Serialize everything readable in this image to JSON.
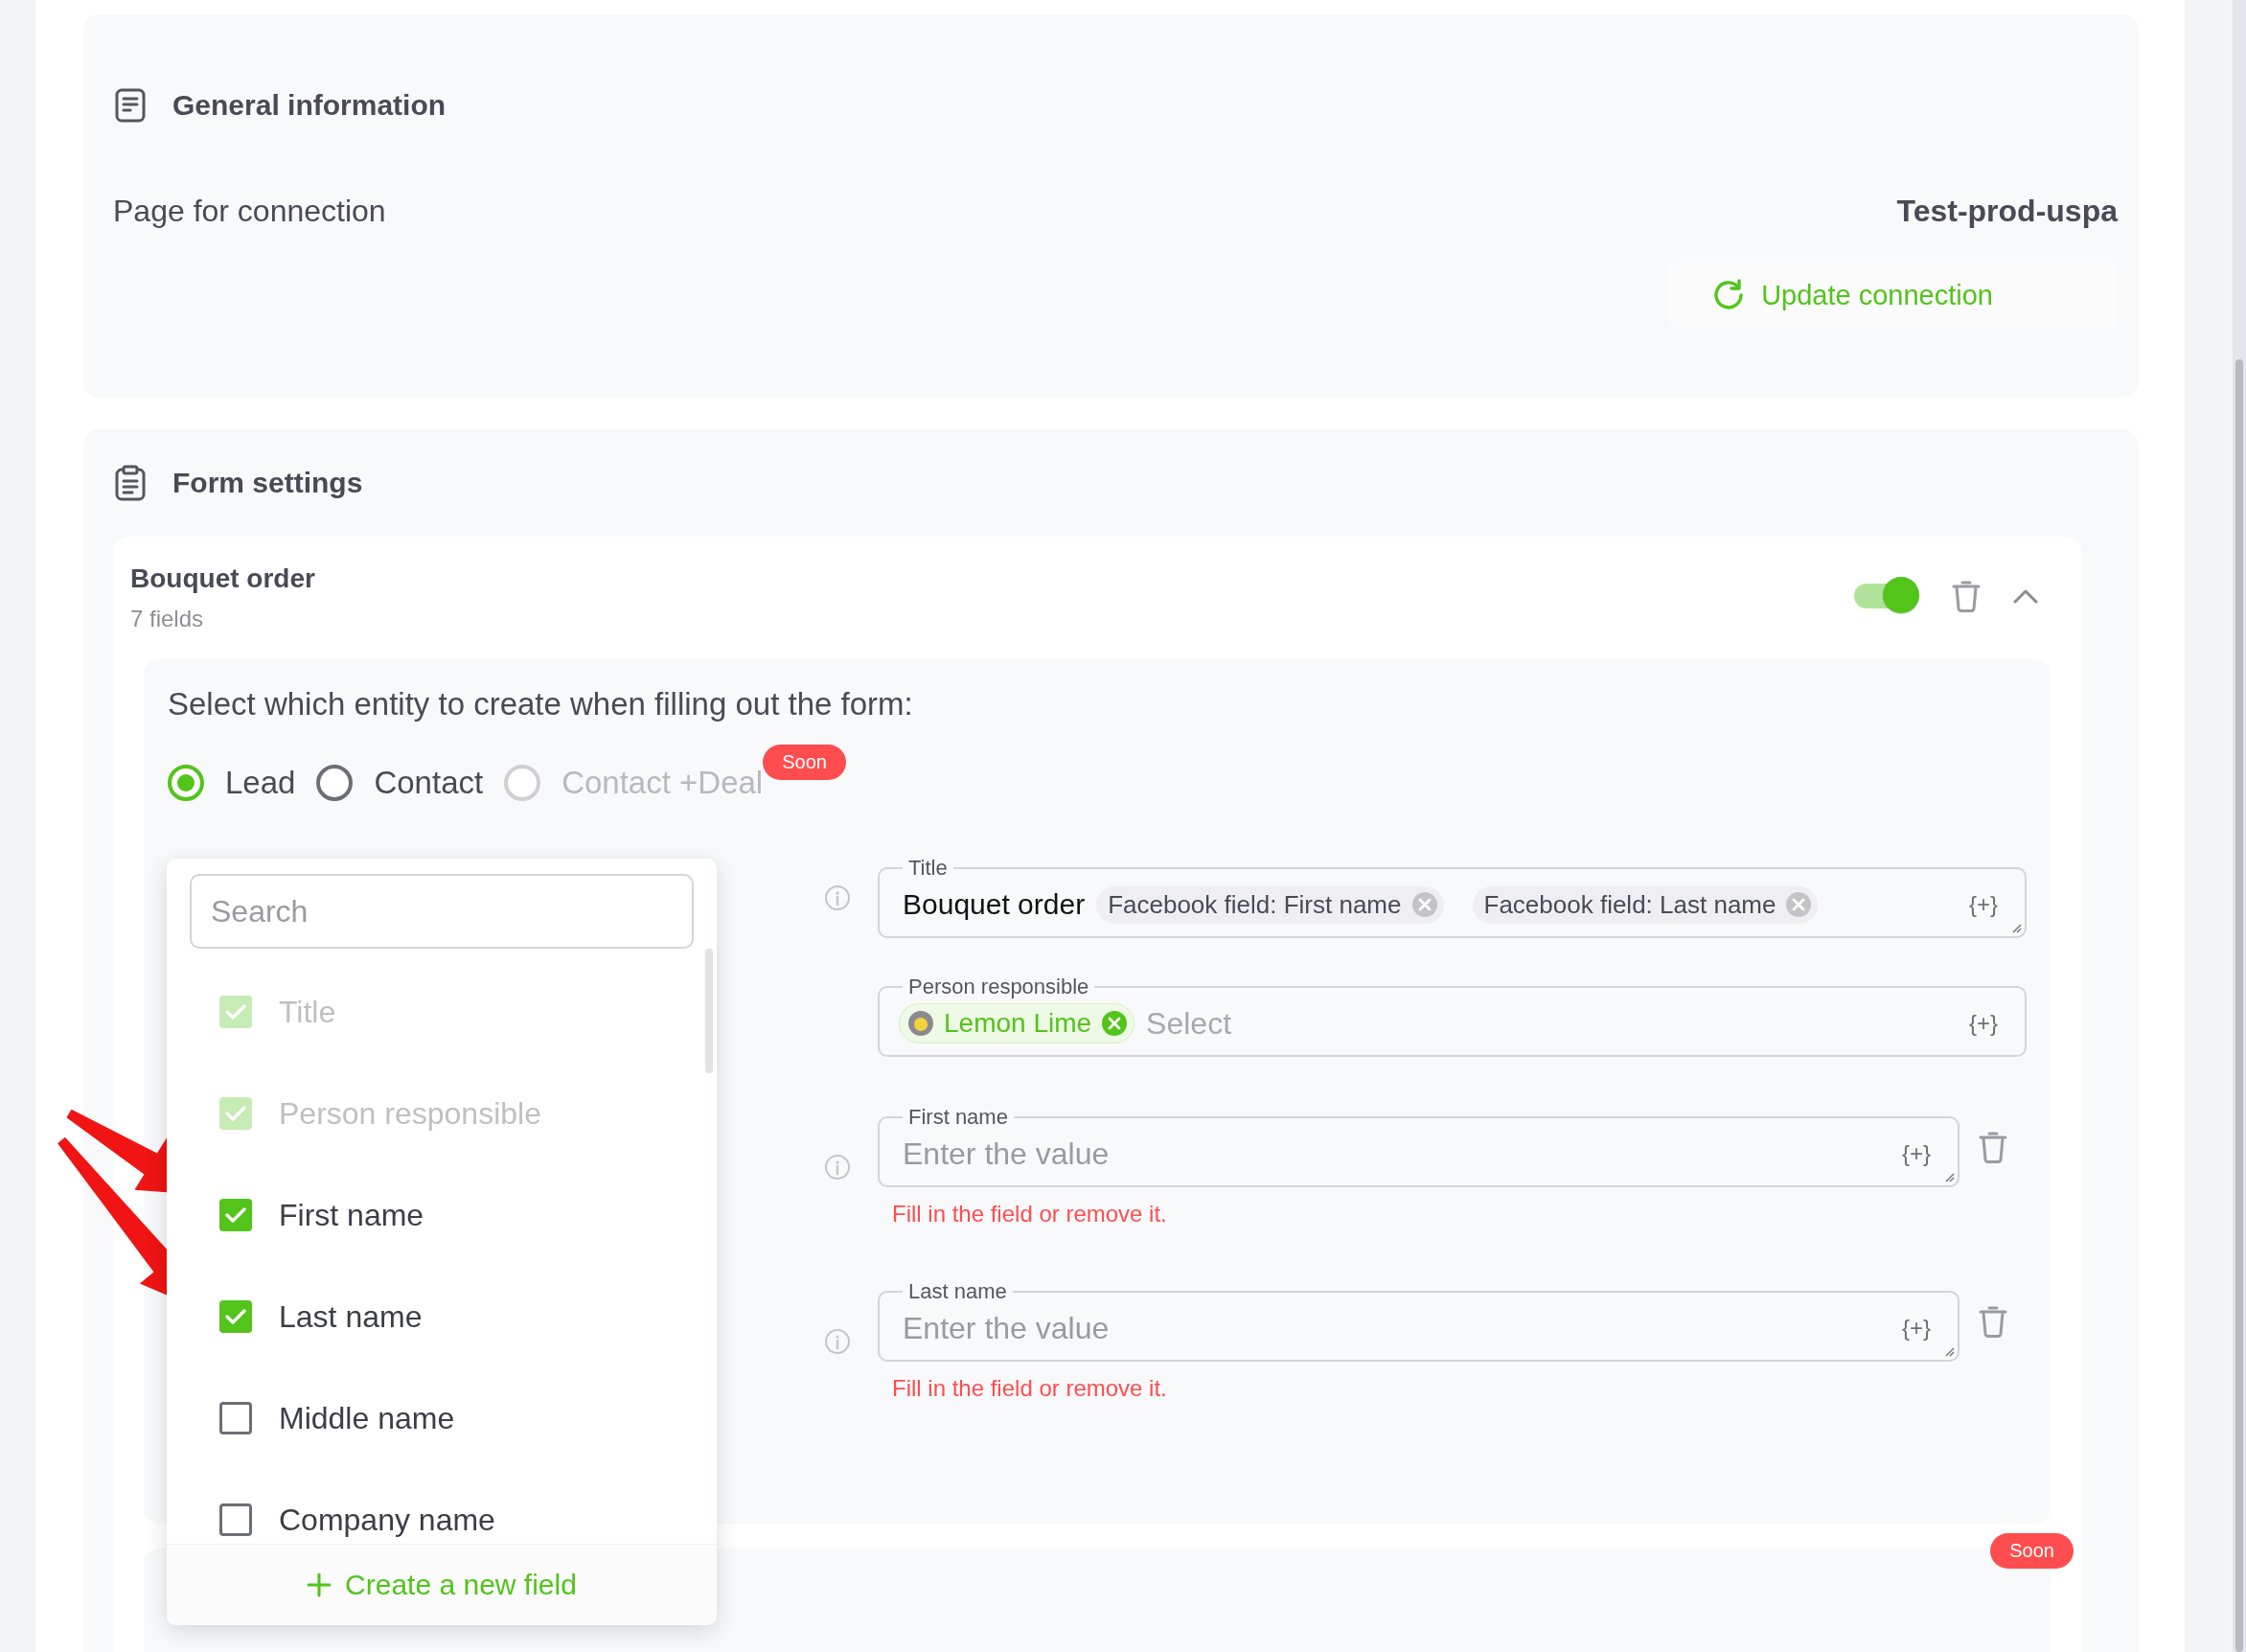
{
  "general": {
    "title": "General information",
    "page_label": "Page for connection",
    "page_value": "Test-prod-uspa",
    "update_button": "Update connection"
  },
  "form_settings": {
    "title": "Form settings",
    "form": {
      "name": "Bouquet order",
      "field_count": "7 fields",
      "enabled": true,
      "expanded": true,
      "entity_prompt": "Select which entity to create when filling out the form:",
      "entities": [
        {
          "label": "Lead",
          "selected": true,
          "disabled": false
        },
        {
          "label": "Contact",
          "selected": false,
          "disabled": false
        },
        {
          "label": "Contact +Deal",
          "selected": false,
          "disabled": true,
          "badge": "Soon"
        }
      ],
      "field_picker": {
        "search_placeholder": "Search",
        "items": [
          {
            "label": "Title",
            "checked": true,
            "disabled": true
          },
          {
            "label": "Person responsible",
            "checked": true,
            "disabled": true
          },
          {
            "label": "First name",
            "checked": true,
            "disabled": false
          },
          {
            "label": "Last name",
            "checked": true,
            "disabled": false
          },
          {
            "label": "Middle name",
            "checked": false,
            "disabled": false
          },
          {
            "label": "Company name",
            "checked": false,
            "disabled": false
          }
        ],
        "create_button": "Create a new field"
      },
      "fields": [
        {
          "kind": "tags",
          "label": "Title",
          "value": "Bouquet order",
          "tags": [
            "Facebook field: First name",
            "Facebook field: Last name"
          ],
          "insert": "{+}",
          "info": true,
          "removable": false
        },
        {
          "kind": "user",
          "label": "Person responsible",
          "user": "Lemon Lime",
          "placeholder": "Select",
          "insert": "{+}",
          "info": false,
          "removable": false
        },
        {
          "kind": "text",
          "label": "First name",
          "placeholder": "Enter the value",
          "insert": "{+}",
          "error": "Fill in the field or remove it.",
          "info": true,
          "removable": true
        },
        {
          "kind": "text",
          "label": "Last name",
          "placeholder": "Enter the value",
          "insert": "{+}",
          "error": "Fill in the field or remove it.",
          "info": true,
          "removable": true
        }
      ]
    },
    "next_form": {
      "badge": "Soon"
    }
  }
}
